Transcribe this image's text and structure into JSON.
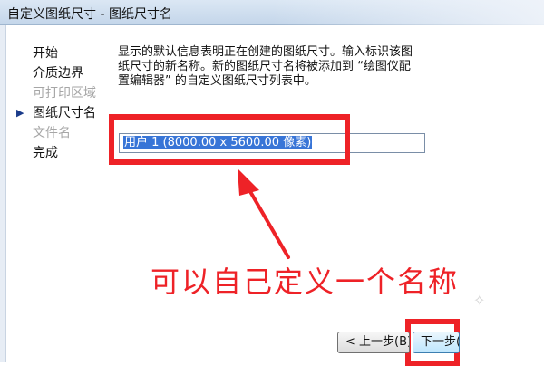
{
  "window": {
    "title": "自定义图纸尺寸 - 图纸尺寸名"
  },
  "nav": {
    "items": [
      {
        "label": "开始",
        "state": "normal"
      },
      {
        "label": "介质边界",
        "state": "normal"
      },
      {
        "label": "可打印区域",
        "state": "disabled"
      },
      {
        "label": "图纸尺寸名",
        "state": "current"
      },
      {
        "label": "文件名",
        "state": "disabled"
      },
      {
        "label": "完成",
        "state": "normal"
      }
    ],
    "current_marker": "▶"
  },
  "description": {
    "lines": [
      "显示的默认信息表明正在创建的图纸尺寸。输入标识该图",
      "纸尺寸的新名称。新的图纸尺寸名将被添加到 “绘图仪配",
      "置编辑器” 的自定义图纸尺寸列表中。"
    ]
  },
  "name_input": {
    "value": "用户 1 (8000.00 x 5600.00 像素)"
  },
  "annotation": {
    "text": "可以自己定义一个名称",
    "color": "#ee2227"
  },
  "buttons": {
    "back": "< 上一步(B)",
    "next": "下一步("
  }
}
